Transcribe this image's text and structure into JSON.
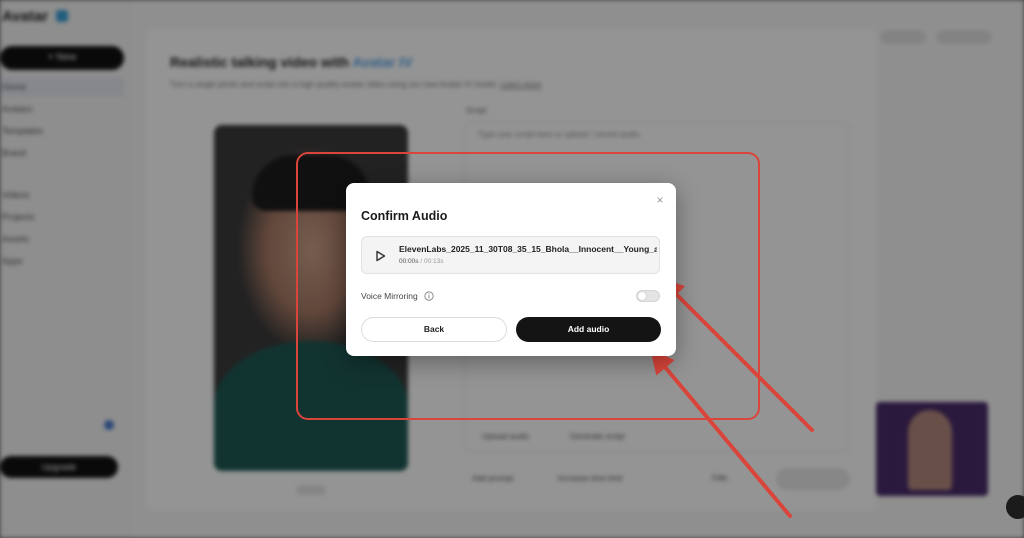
{
  "background_app": {
    "logo": "Avatar",
    "new_button": "+ New",
    "nav_items": [
      "Home",
      "Avatars",
      "Templates",
      "Brand",
      "Videos",
      "Projects",
      "Assets",
      "Apps"
    ],
    "upgrade_button": "Upgrade",
    "modal": {
      "title": "Realistic talking video with ",
      "title_accent": "Avatar IV",
      "subtitle": "Turn a single photo and script into a high quality avatar video using our new Avatar IV model.",
      "learn_more": "Learn more",
      "script_label": "Script",
      "script_hint": "Type your script here or upload / record audio",
      "tools": [
        "Upload audio",
        "Generate script"
      ],
      "bottom_tools": [
        "Add prompt",
        "Increase time limit"
      ],
      "model_select": "Fifth"
    }
  },
  "dialog": {
    "title": "Confirm Audio",
    "close_icon": "×",
    "audio": {
      "file_name": "ElevenLabs_2025_11_30T08_35_15_Bhola__Innocent__Young_ar",
      "current_time": "00:00s",
      "separator": " / ",
      "duration": "00:13s"
    },
    "voice_mirroring_label": "Voice Mirroring",
    "voice_mirroring_enabled": false,
    "back_button": "Back",
    "add_audio_button": "Add audio"
  },
  "colors": {
    "annotation_red": "#d9453b",
    "primary_button": "#141414",
    "accent": "#5aa6e8"
  }
}
